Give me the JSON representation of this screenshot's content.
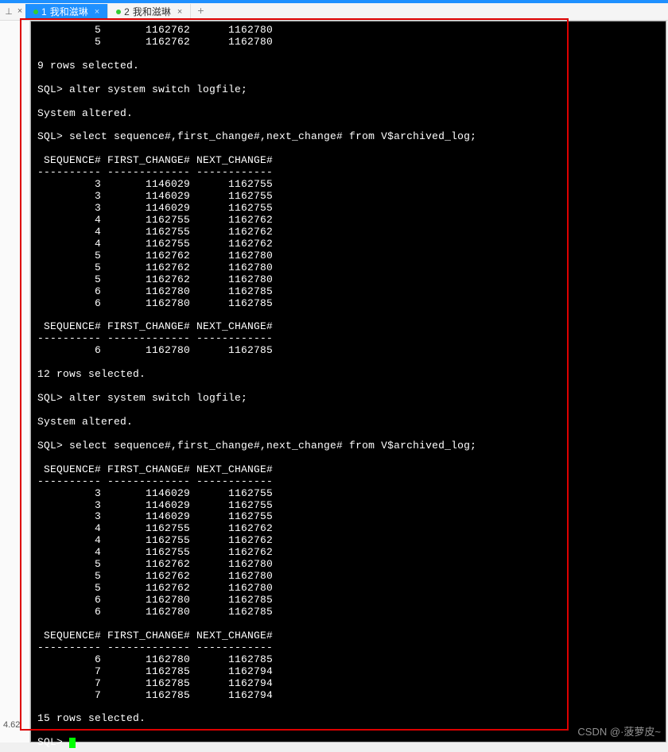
{
  "tabs": {
    "pin": "⊥",
    "close": "×",
    "items": [
      {
        "dot": true,
        "num": "1",
        "label": "我和滋琳",
        "active": true
      },
      {
        "dot": true,
        "num": "2",
        "label": "我和滋琳",
        "active": false
      }
    ],
    "plus": "+"
  },
  "left_label": "4.62",
  "watermark": "CSDN @·菠萝皮~",
  "terminal": {
    "prompt": "SQL> ",
    "sep10": "----------",
    "sep13": "-------------",
    "sep12": "------------",
    "block0_rows": [
      {
        "s": "5",
        "f": "1162762",
        "n": "1162780"
      },
      {
        "s": "5",
        "f": "1162762",
        "n": "1162780"
      }
    ],
    "rows9": "9 rows selected.",
    "alter_cmd": "alter system switch logfile;",
    "system_altered": "System altered.",
    "select_cmd": "select sequence#,first_change#,next_change# from V$archived_log;",
    "hdr": " SEQUENCE# FIRST_CHANGE# NEXT_CHANGE#",
    "block1_rows": [
      {
        "s": "3",
        "f": "1146029",
        "n": "1162755"
      },
      {
        "s": "3",
        "f": "1146029",
        "n": "1162755"
      },
      {
        "s": "3",
        "f": "1146029",
        "n": "1162755"
      },
      {
        "s": "4",
        "f": "1162755",
        "n": "1162762"
      },
      {
        "s": "4",
        "f": "1162755",
        "n": "1162762"
      },
      {
        "s": "4",
        "f": "1162755",
        "n": "1162762"
      },
      {
        "s": "5",
        "f": "1162762",
        "n": "1162780"
      },
      {
        "s": "5",
        "f": "1162762",
        "n": "1162780"
      },
      {
        "s": "5",
        "f": "1162762",
        "n": "1162780"
      },
      {
        "s": "6",
        "f": "1162780",
        "n": "1162785"
      },
      {
        "s": "6",
        "f": "1162780",
        "n": "1162785"
      }
    ],
    "block1b_rows": [
      {
        "s": "6",
        "f": "1162780",
        "n": "1162785"
      }
    ],
    "rows12": "12 rows selected.",
    "block2_rows": [
      {
        "s": "3",
        "f": "1146029",
        "n": "1162755"
      },
      {
        "s": "3",
        "f": "1146029",
        "n": "1162755"
      },
      {
        "s": "3",
        "f": "1146029",
        "n": "1162755"
      },
      {
        "s": "4",
        "f": "1162755",
        "n": "1162762"
      },
      {
        "s": "4",
        "f": "1162755",
        "n": "1162762"
      },
      {
        "s": "4",
        "f": "1162755",
        "n": "1162762"
      },
      {
        "s": "5",
        "f": "1162762",
        "n": "1162780"
      },
      {
        "s": "5",
        "f": "1162762",
        "n": "1162780"
      },
      {
        "s": "5",
        "f": "1162762",
        "n": "1162780"
      },
      {
        "s": "6",
        "f": "1162780",
        "n": "1162785"
      },
      {
        "s": "6",
        "f": "1162780",
        "n": "1162785"
      }
    ],
    "block2b_rows": [
      {
        "s": "6",
        "f": "1162780",
        "n": "1162785"
      },
      {
        "s": "7",
        "f": "1162785",
        "n": "1162794"
      },
      {
        "s": "7",
        "f": "1162785",
        "n": "1162794"
      },
      {
        "s": "7",
        "f": "1162785",
        "n": "1162794"
      }
    ],
    "rows15": "15 rows selected."
  }
}
